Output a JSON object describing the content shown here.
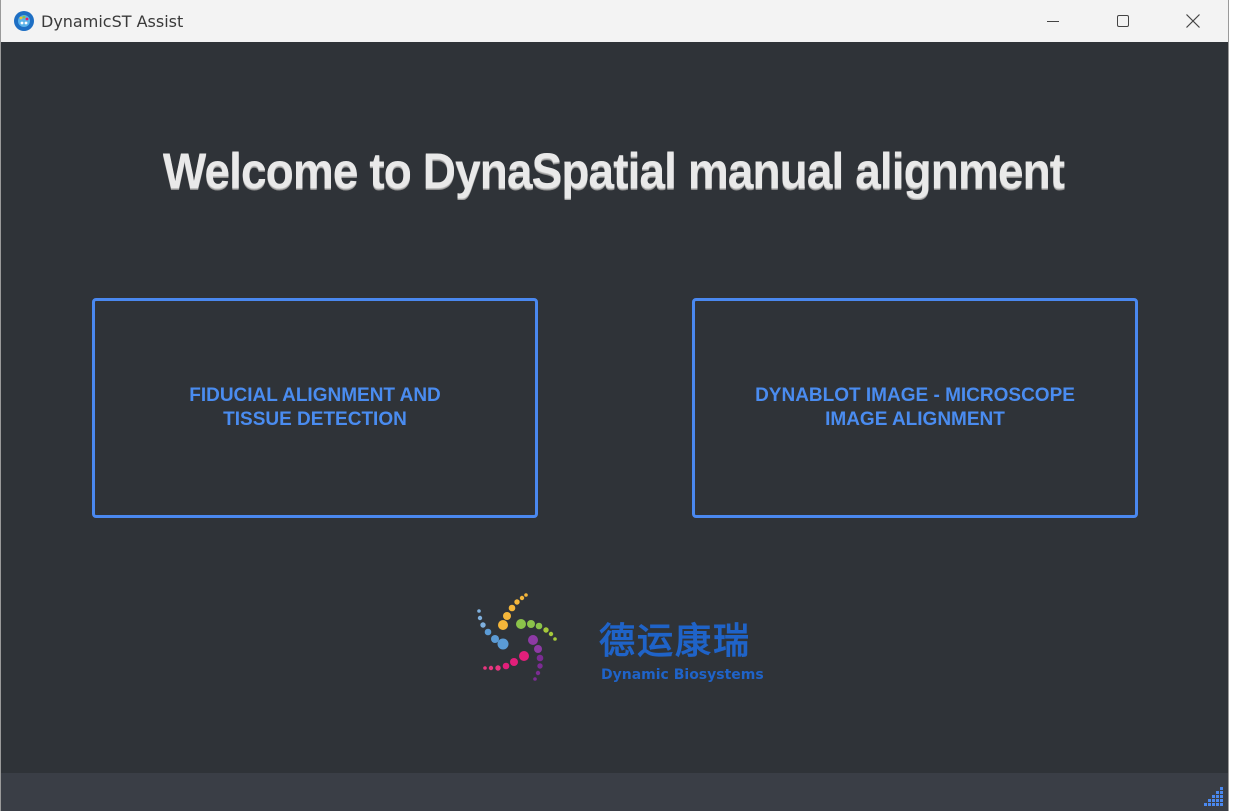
{
  "window": {
    "title": "DynamicST Assist"
  },
  "main": {
    "welcome": "Welcome to DynaSpatial manual alignment",
    "buttons": [
      {
        "line1": "FIDUCIAL ALIGNMENT AND",
        "line2": "TISSUE DETECTION"
      },
      {
        "line1": "DYNABLOT IMAGE - MICROSCOPE",
        "line2": "IMAGE ALIGNMENT"
      }
    ]
  },
  "logo": {
    "chinese": "德运康瑞",
    "english": "Dynamic Biosystems"
  },
  "colors": {
    "background": "#2f3338",
    "accent": "#4a88ef",
    "logo_blue": "#1f63c8"
  },
  "icons": [
    "app-icon",
    "minimize-icon",
    "maximize-icon",
    "close-icon",
    "resize-grip-icon"
  ]
}
